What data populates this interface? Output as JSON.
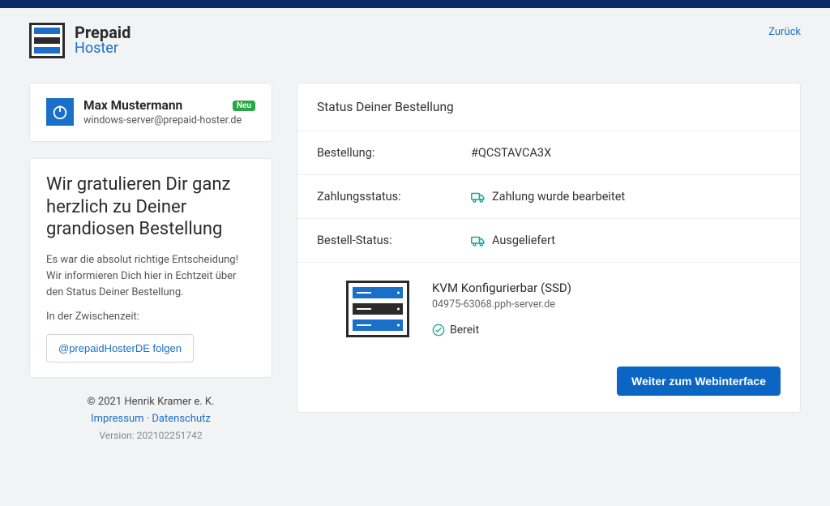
{
  "header": {
    "brand_top": "Prepaid",
    "brand_bottom": "Hoster",
    "back_label": "Zurück"
  },
  "user": {
    "name": "Max Mustermann",
    "badge": "Neu",
    "email": "windows-server@prepaid-hoster.de"
  },
  "congrats": {
    "title": "Wir gratulieren Dir ganz herzlich zu Deiner grandiosen Bestellung",
    "text": "Es war die absolut richtige Entscheidung! Wir informieren Dich hier in Echtzeit über den Status Deiner Bestellung.",
    "meanwhile": "In der Zwischenzeit:",
    "follow_label": "@prepaidHosterDE folgen"
  },
  "footer": {
    "copyright": "© 2021 Henrik Kramer e. K.",
    "impressum": "Impressum",
    "sep": " · ",
    "datenschutz": "Datenschutz",
    "version": "Version: 202102251742"
  },
  "status": {
    "header": "Status Deiner Bestellung",
    "order_label": "Bestellung:",
    "order_value": "#QCSTAVCA3X",
    "payment_label": "Zahlungsstatus:",
    "payment_value": "Zahlung wurde bearbeitet",
    "orderstatus_label": "Bestell-Status:",
    "orderstatus_value": "Ausgeliefert",
    "product_name": "KVM Konfigurierbar (SSD)",
    "product_host": "04975-63068.pph-server.de",
    "product_status": "Bereit",
    "cta": "Weiter zum Webinterface"
  }
}
